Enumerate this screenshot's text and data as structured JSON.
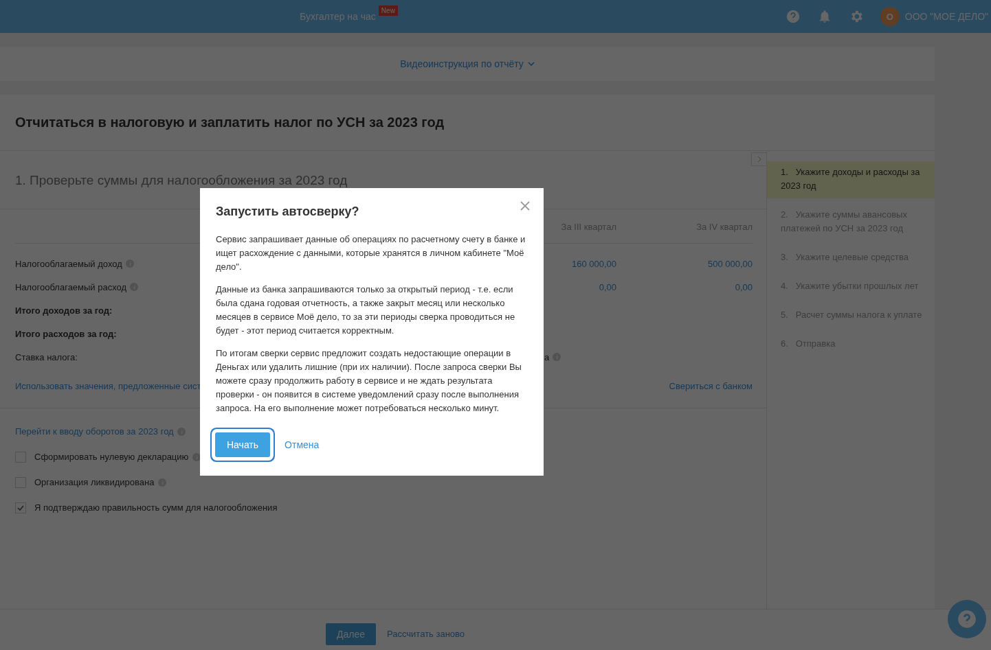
{
  "topbar": {
    "service": "Бухгалтер на час",
    "badge": "New",
    "avatar": "О",
    "company": "ООО \"МОЕ ДЕЛО\""
  },
  "video_link": "Видеоинструкция по отчёту",
  "page_title": "Отчитаться в налоговую и заплатить налог по УСН за 2023 год",
  "section_title": "1. Проверьте суммы для налогообложения за 2023 год",
  "table": {
    "columns": [
      "За III квартал",
      "За IV квартал"
    ],
    "rows": [
      {
        "kind": "value",
        "label": "Налогооблагаемый доход",
        "info": true,
        "values": [
          "160 000,00",
          "500 000,00"
        ]
      },
      {
        "kind": "value",
        "label": "Налогооблагаемый расход",
        "info": true,
        "values": [
          "0,00",
          "0,00"
        ]
      },
      {
        "kind": "total",
        "label": "Итого доходов за год:"
      },
      {
        "kind": "total",
        "label": "Итого расходов за год:"
      },
      {
        "kind": "rate",
        "label": "Ставка налога:",
        "fragment": "а"
      }
    ]
  },
  "suggest_link": "Использовать значения, предложенные сист",
  "bank_link": "Свериться с банком",
  "turnover_link": "Перейти к вводу оборотов за 2023 год",
  "checkboxes": [
    {
      "label": "Сформировать нулевую декларацию",
      "checked": false
    },
    {
      "label": "Организация ликвидирована",
      "checked": false
    },
    {
      "label": "Я подтверждаю правильность сумм для налогообложения",
      "checked": true
    }
  ],
  "steps": [
    {
      "number": "1.",
      "label": "Укажите доходы и расходы за 2023 год",
      "selected": true
    },
    {
      "number": "2.",
      "label": "Укажите суммы авансовых платежей по УСН за 2023 год",
      "selected": false
    },
    {
      "number": "3.",
      "label": "Укажите целевые средства",
      "selected": false
    },
    {
      "number": "4.",
      "label": "Укажите убытки прошлых лет",
      "selected": false
    },
    {
      "number": "5.",
      "label": "Расчет суммы налога к уплате",
      "selected": false
    },
    {
      "number": "6.",
      "label": "Отправка",
      "selected": false
    }
  ],
  "footer": {
    "next": "Далее",
    "recalc": "Рассчитать заново"
  },
  "dialog": {
    "title": "Запустить автосверку?",
    "paragraphs": [
      "Сервис запрашивает данные об операциях по расчетному счету в банке и ищет расхождение с данными, которые хранятся в личном кабинете \"Моё дело\".",
      "Данные из банка запрашиваются только за открытый период - т.е. если была сдана годовая отчетность, а также закрыт месяц или несколько месяцев в сервисе Моё дело, то за эти периоды сверка проводиться не будет - этот период считается корректным.",
      "По итогам сверки сервис предложит создать недостающие операции в Деньгах или удалить лишние (при их наличии). После запроса сверки Вы можете сразу продолжить работу в сервисе и не ждать результата проверки - он появится в системе уведомлений сразу после выполнения запроса. На его выполнение может потребоваться несколько минут."
    ],
    "confirm": "Начать",
    "cancel": "Отмена"
  }
}
